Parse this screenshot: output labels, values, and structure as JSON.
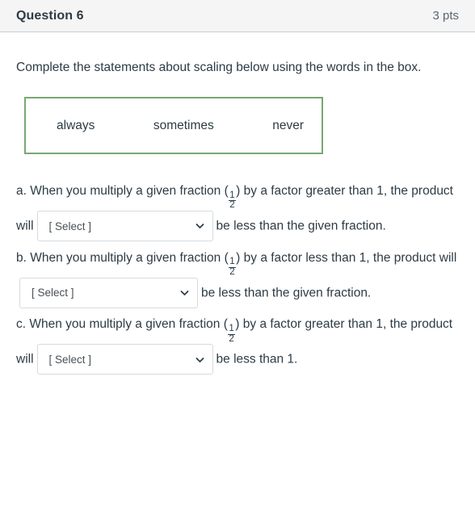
{
  "header": {
    "question_name": "Question 6",
    "points": "3 pts"
  },
  "prompt": "Complete the statements about scaling below using the words in the box.",
  "word_bank": {
    "words": [
      "always",
      "sometimes",
      "never"
    ],
    "border_color": "#77a873"
  },
  "statements": [
    {
      "label": "a.",
      "text_before": "a. When you multiply a given fraction (",
      "fraction": {
        "numerator": "1",
        "denominator": "2"
      },
      "text_middle": ") by a factor greater than 1, the product will",
      "select": {
        "value": "[ Select ]",
        "icon": "chevron-down-icon"
      },
      "text_after": "be less than the given fraction."
    },
    {
      "label": "b.",
      "text_before": "b. When you multiply a given fraction (",
      "fraction": {
        "numerator": "1",
        "denominator": "2"
      },
      "text_middle": ") by a factor less than 1, the product will",
      "select": {
        "value": "[ Select ]",
        "icon": "chevron-down-icon"
      },
      "text_after": "be less than the given fraction."
    },
    {
      "label": "c.",
      "text_before": "c. When you multiply a given fraction (",
      "fraction": {
        "numerator": "1",
        "denominator": "2"
      },
      "text_middle": ") by a factor greater than 1, the product will",
      "select": {
        "value": "[ Select ]",
        "icon": "chevron-down-icon"
      },
      "text_after": "be less than 1."
    }
  ],
  "colors": {
    "header_bg": "#f5f5f5",
    "text": "#2d3b45",
    "muted_text": "#5b6670",
    "select_border": "#d7dade"
  }
}
